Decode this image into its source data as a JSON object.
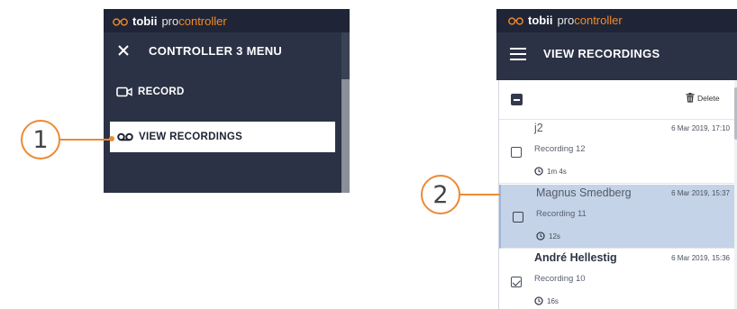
{
  "brand": {
    "name_bold": "tobii",
    "name_pro": "pro",
    "name_controller": "controller"
  },
  "menu": {
    "title": "CONTROLLER 3 MENU",
    "items": [
      {
        "label": "RECORD",
        "icon": "video-camera-icon"
      },
      {
        "label": "VIEW RECORDINGS",
        "icon": "cassette-tape-icon"
      }
    ]
  },
  "callouts": {
    "one": "1",
    "two": "2"
  },
  "recordings_view": {
    "title": "VIEW RECORDINGS",
    "delete_label": "Delete",
    "rows": [
      {
        "participant": "j2",
        "date": "6 Mar 2019, 17:10",
        "recording": "Recording 12",
        "duration": "1m 4s",
        "checked": false,
        "selected": false
      },
      {
        "participant": "Magnus Smedberg",
        "date": "6 Mar 2019, 15:37",
        "recording": "Recording 11",
        "duration": "12s",
        "checked": false,
        "selected": true
      },
      {
        "participant": "André Hellestig",
        "date": "6 Mar 2019, 15:36",
        "recording": "Recording 10",
        "duration": "16s",
        "checked": true,
        "selected": false
      }
    ]
  },
  "colors": {
    "navy": "#2b3245",
    "navy_dark": "#1f2536",
    "accent_orange": "#f28a2a",
    "selected_row": "#c4d3e8"
  }
}
